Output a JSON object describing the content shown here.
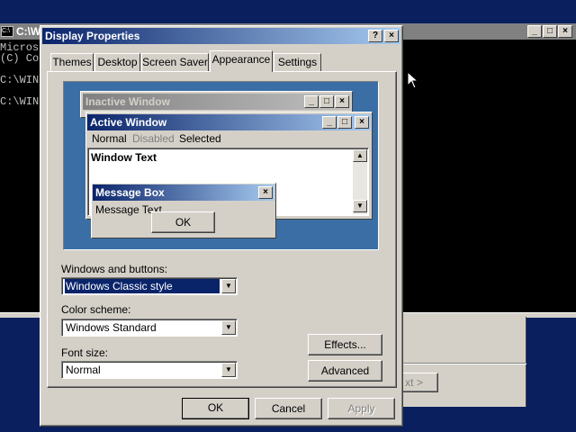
{
  "console": {
    "title": "C:\\W",
    "icon": "C:\\",
    "lines": [
      "Micros",
      "(C) Co",
      "",
      "C:\\WIN",
      "",
      "C:\\WIN"
    ]
  },
  "wizard": {
    "next_label": "xt >"
  },
  "dialog": {
    "title": "Display Properties",
    "help": "?",
    "close": "×",
    "tabs": [
      {
        "label": "Themes"
      },
      {
        "label": "Desktop"
      },
      {
        "label": "Screen Saver"
      },
      {
        "label": "Appearance"
      },
      {
        "label": "Settings"
      }
    ],
    "active_tab": "Appearance",
    "preview": {
      "inactive_title": "Inactive Window",
      "active_title": "Active Window",
      "menu_normal": "Normal",
      "menu_disabled": "Disabled",
      "menu_selected": "Selected",
      "window_text": "Window Text",
      "msgbox_title": "Message Box",
      "msgbox_text": "Message Text",
      "msgbox_ok": "OK"
    },
    "fields": {
      "windows_buttons_label": "Windows and buttons:",
      "windows_buttons_value": "Windows Classic style",
      "color_scheme_label": "Color scheme:",
      "color_scheme_value": "Windows Standard",
      "font_size_label": "Font size:",
      "font_size_value": "Normal"
    },
    "effects_label": "Effects...",
    "advanced_label": "Advanced",
    "ok_label": "OK",
    "cancel_label": "Cancel",
    "apply_label": "Apply"
  }
}
